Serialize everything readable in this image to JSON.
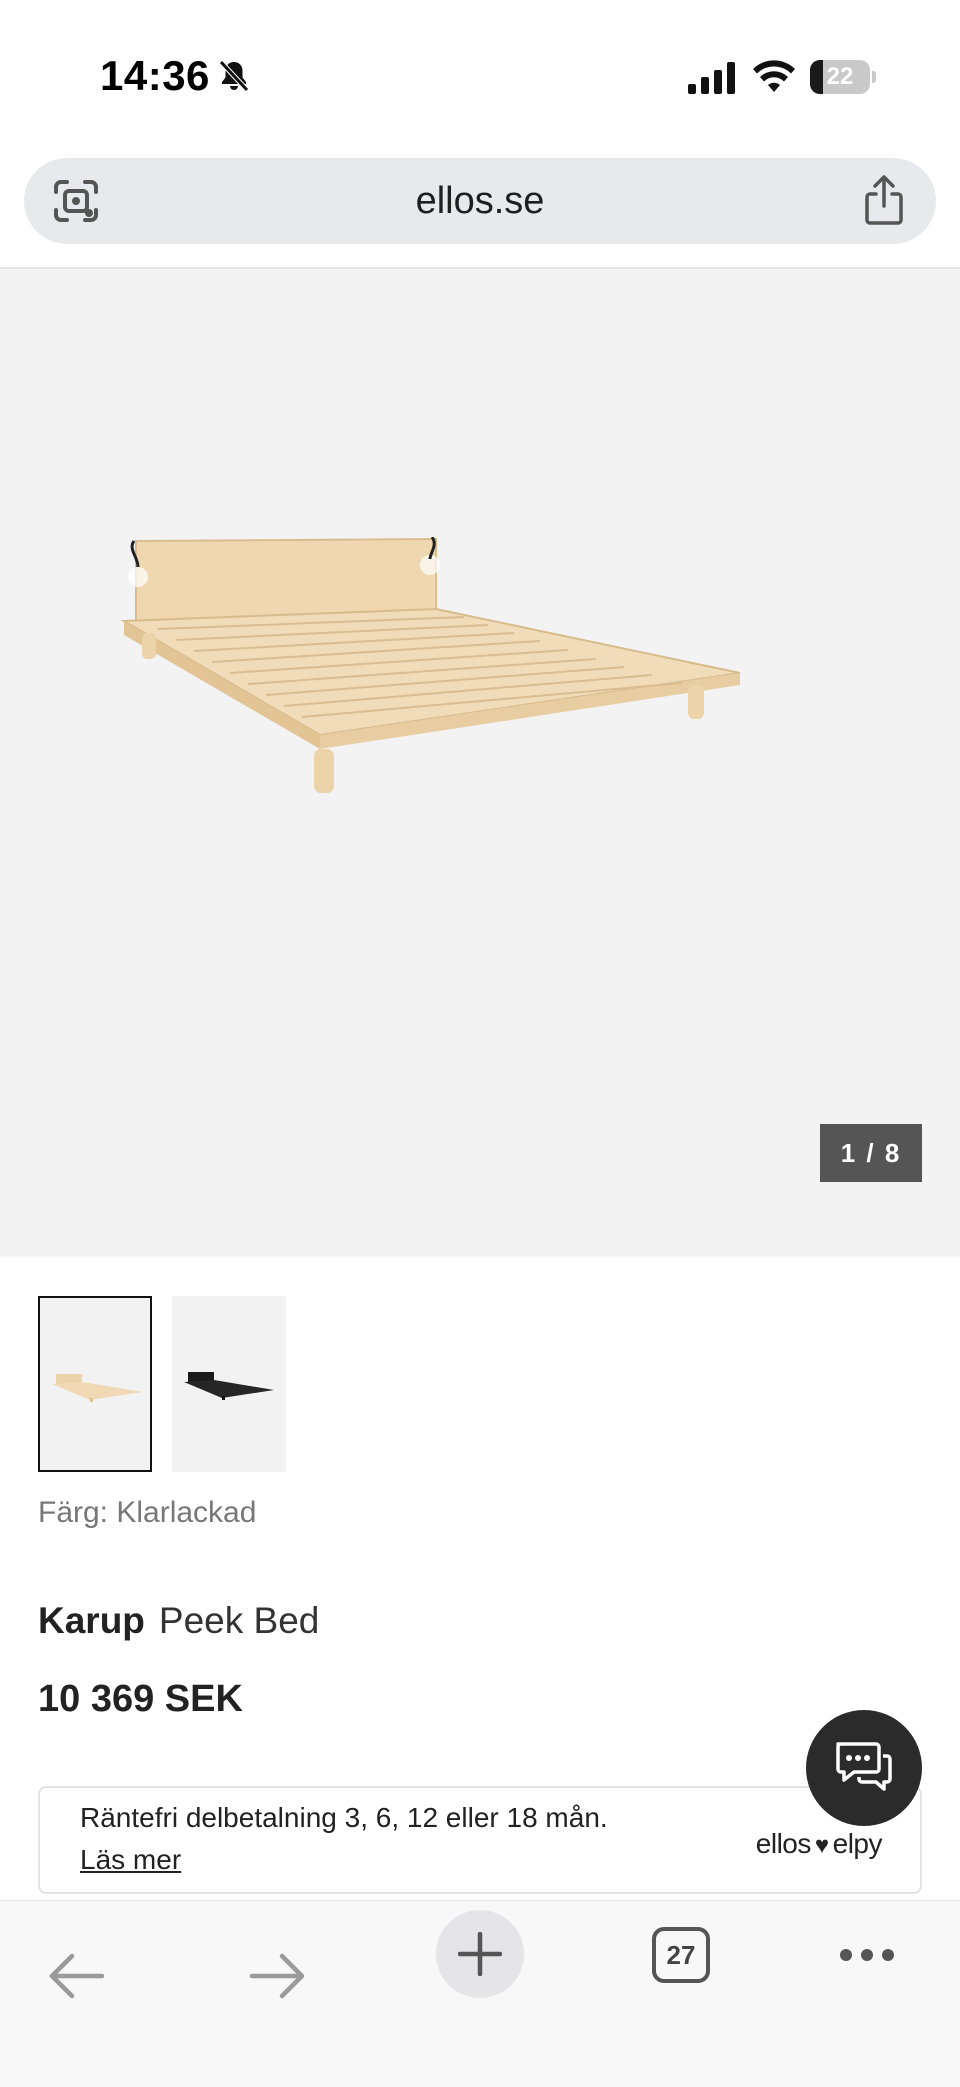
{
  "status_bar": {
    "time": "14:36",
    "battery_level": "22",
    "icons": [
      "bell-slash-icon",
      "signal-icon",
      "wifi-icon",
      "battery-icon"
    ]
  },
  "browser": {
    "url": "ellos.se",
    "icons": [
      "camera-lens-icon",
      "share-icon"
    ]
  },
  "gallery": {
    "counter": "1 / 8",
    "thumbnails": [
      "natural-bed-thumb",
      "black-bed-thumb"
    ]
  },
  "product": {
    "color_label": "Färg: Klarlackad",
    "brand": "Karup",
    "name": "Peek Bed",
    "price": "10 369 SEK"
  },
  "installment": {
    "text": "Räntefri delbetalning 3, 6, 12 eller 18 mån.",
    "link": "Läs mer",
    "logo_left": "ellos",
    "logo_heart": "♥",
    "logo_right": "elpy"
  },
  "toolbar": {
    "tab_count": "27",
    "icons": [
      "back-arrow-icon",
      "forward-arrow-icon",
      "plus-icon",
      "tabs-icon",
      "more-icon"
    ]
  },
  "colors": {
    "hero_bg": "#f3f3f3",
    "chat_bg": "#2b2b2b",
    "counter_bg": "#555555"
  }
}
